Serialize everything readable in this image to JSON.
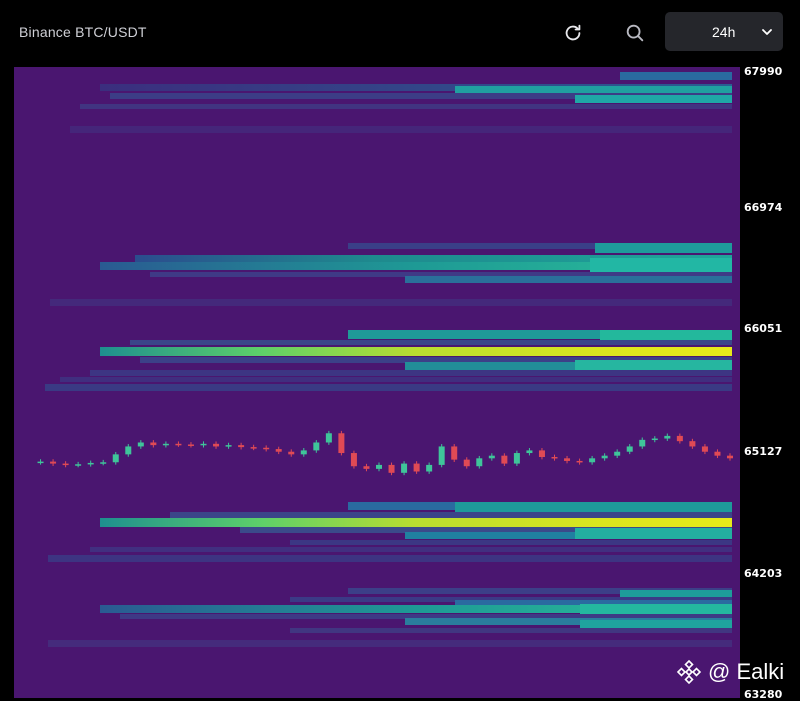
{
  "header": {
    "title": "Binance BTC/USDT",
    "timeframe": {
      "selected": "24h"
    }
  },
  "icons": {
    "refresh": "refresh-icon",
    "search": "search-icon",
    "dropdown": "chevron-down-icon"
  },
  "price_axis": {
    "labels": [
      "67990",
      "66974",
      "66051",
      "65127",
      "64203",
      "63280"
    ]
  },
  "watermark": {
    "text": "@ Ealki"
  },
  "colors": {
    "background": "#4a1670",
    "low": "#3d2a7e",
    "mid": "#1f8f8f",
    "high": "#dfe81c",
    "candle_up": "#3fc59a",
    "candle_down": "#e04a55"
  },
  "chart_data": {
    "type": "heatmap",
    "title": "Binance BTC/USDT",
    "period": "24h",
    "y_ticks": [
      67990,
      66974,
      66051,
      65127,
      64203,
      63280
    ],
    "ylim": [
      63280,
      67990
    ],
    "liquidity_levels": [
      {
        "price": 67860,
        "intensity": 0.55
      },
      {
        "price": 67760,
        "intensity": 0.5
      },
      {
        "price": 66710,
        "intensity": 0.55
      },
      {
        "price": 66620,
        "intensity": 0.5
      },
      {
        "price": 66040,
        "intensity": 0.9
      },
      {
        "price": 65990,
        "intensity": 0.45
      },
      {
        "price": 64670,
        "intensity": 0.95
      },
      {
        "price": 64590,
        "intensity": 0.5
      },
      {
        "price": 63860,
        "intensity": 0.6
      },
      {
        "price": 63780,
        "intensity": 0.45
      }
    ],
    "price_series": [
      65030,
      65035,
      65020,
      65010,
      65015,
      65025,
      65030,
      65090,
      65150,
      65180,
      65160,
      65170,
      65165,
      65160,
      65170,
      65150,
      65160,
      65145,
      65140,
      65130,
      65110,
      65090,
      65120,
      65180,
      65250,
      65100,
      65000,
      64980,
      65010,
      64950,
      65020,
      64960,
      65010,
      65150,
      65050,
      65000,
      65060,
      65080,
      65020,
      65100,
      65120,
      65070,
      65060,
      65040,
      65030,
      65060,
      65080,
      65110,
      65150,
      65200,
      65210,
      65230,
      65190,
      65150,
      65110,
      65080,
      65060
    ]
  }
}
